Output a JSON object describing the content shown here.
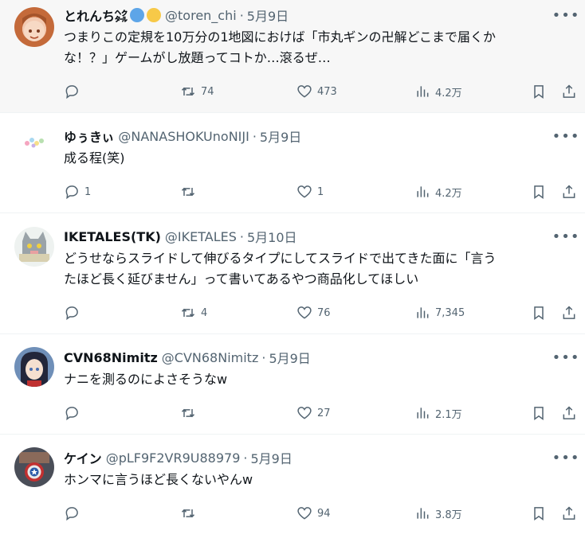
{
  "tweets": [
    {
      "name": "とれんち",
      "name_suffix": "㌶",
      "handle": "@toren_chi",
      "date": "5月9日",
      "text_lines": [
        "つまりこの定規を10万分の1地図におけば「市丸ギンの卍解どこまで届くか",
        "な！？」ゲームがし放題ってコトか…滾るぜ…"
      ],
      "reply_count": "",
      "retweet_count": "74",
      "like_count": "473",
      "view_count": "4.2万"
    },
    {
      "name": "ゆぅきぃ",
      "handle": "@NANASHOKUnoNIJI",
      "date": "5月9日",
      "text_lines": [
        "成る程(笑)"
      ],
      "reply_count": "1",
      "retweet_count": "",
      "like_count": "1",
      "view_count": "4.2万"
    },
    {
      "name": "IKETALES(TK)",
      "handle": "@IKETALES",
      "date": "5月10日",
      "text_lines": [
        "どうせならスライドして伸びるタイプにしてスライドで出てきた面に「言う",
        "たほど長く延びません」って書いてあるやつ商品化してほしい"
      ],
      "reply_count": "",
      "retweet_count": "4",
      "like_count": "76",
      "view_count": "7,345"
    },
    {
      "name": "CVN68Nimitz",
      "handle": "@CVN68Nimitz",
      "date": "5月9日",
      "text_lines": [
        "ナニを測るのによさそうなw"
      ],
      "reply_count": "",
      "retweet_count": "",
      "like_count": "27",
      "view_count": "2.1万"
    },
    {
      "name": "ケイン",
      "handle": "@pLF9F2VR9U88979",
      "date": "5月9日",
      "text_lines": [
        "ホンマに言うほど長くないやんw"
      ],
      "reply_count": "",
      "retweet_count": "",
      "like_count": "94",
      "view_count": "3.8万"
    }
  ],
  "separator": "·",
  "icons": {
    "more": "more-dots-icon",
    "reply": "reply-icon",
    "retweet": "retweet-icon",
    "like": "heart-icon",
    "views": "views-chart-icon",
    "bookmark": "bookmark-icon",
    "share": "share-icon"
  },
  "colors": {
    "text": "#0f1419",
    "secondary": "#536471",
    "highlight_bg": "#f7f7f7",
    "divider": "#eff3f4"
  }
}
